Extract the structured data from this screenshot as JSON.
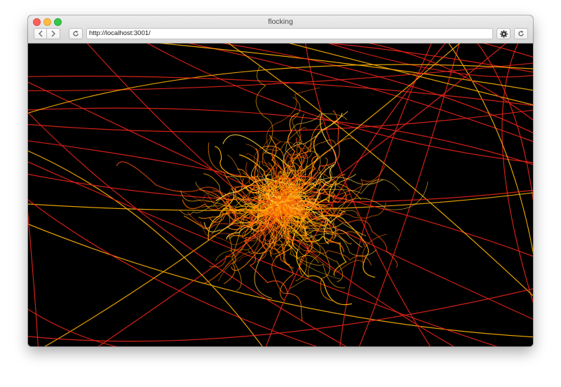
{
  "window": {
    "title": "flocking"
  },
  "toolbar": {
    "url": "http://localhost:3001/",
    "back_icon": "chevron-left-icon",
    "forward_icon": "chevron-right-icon",
    "reload_icon": "reload-icon",
    "settings_icon": "gear-icon"
  },
  "canvas": {
    "background": "#000000",
    "stroke_colors": [
      "#e8231a",
      "#f04a10",
      "#ff6a00",
      "#ff8c00",
      "#ffb300",
      "#ffd040"
    ]
  }
}
